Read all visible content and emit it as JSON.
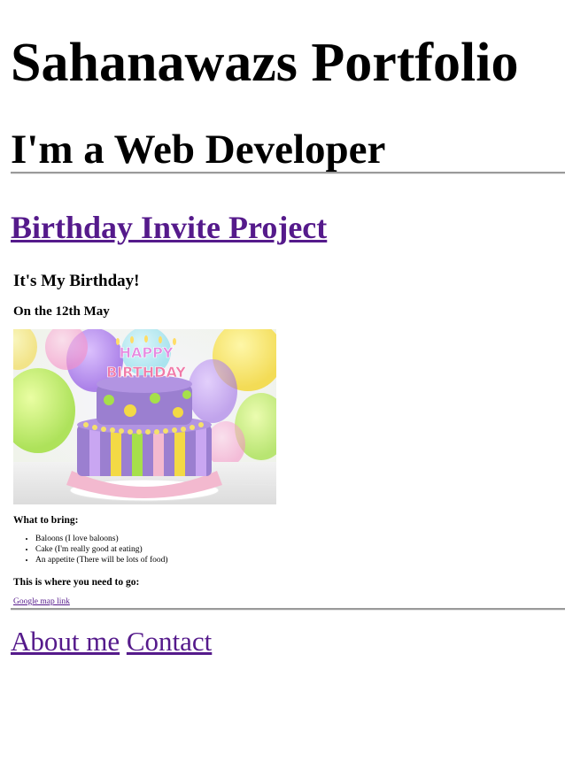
{
  "header": {
    "title": "Sahanawazs Portfolio",
    "subtitle": "I'm a Web Developer"
  },
  "project": {
    "link_text": "Birthday Invite Project"
  },
  "preview": {
    "heading": "It's My Birthday!",
    "date": "On the 12th May",
    "image_alt": "Birthday cake",
    "bring_heading": "What to bring:",
    "bring_items": [
      "Baloons (I love baloons)",
      "Cake (I'm really good at eating)",
      "An appetite (There will be lots of food)"
    ],
    "go_heading": "This is where you need to go:",
    "map_link": "Google map link",
    "cake_text_line1": "HAPPY",
    "cake_text_line2": "BIRTHDAY"
  },
  "footer": {
    "about": "About me",
    "contact": "Contact"
  },
  "colors": {
    "link": "#551a8b",
    "divider": "#9a9a9a",
    "cake_purple": "#9b7fd0",
    "cake_pink": "#f3b9cf"
  }
}
